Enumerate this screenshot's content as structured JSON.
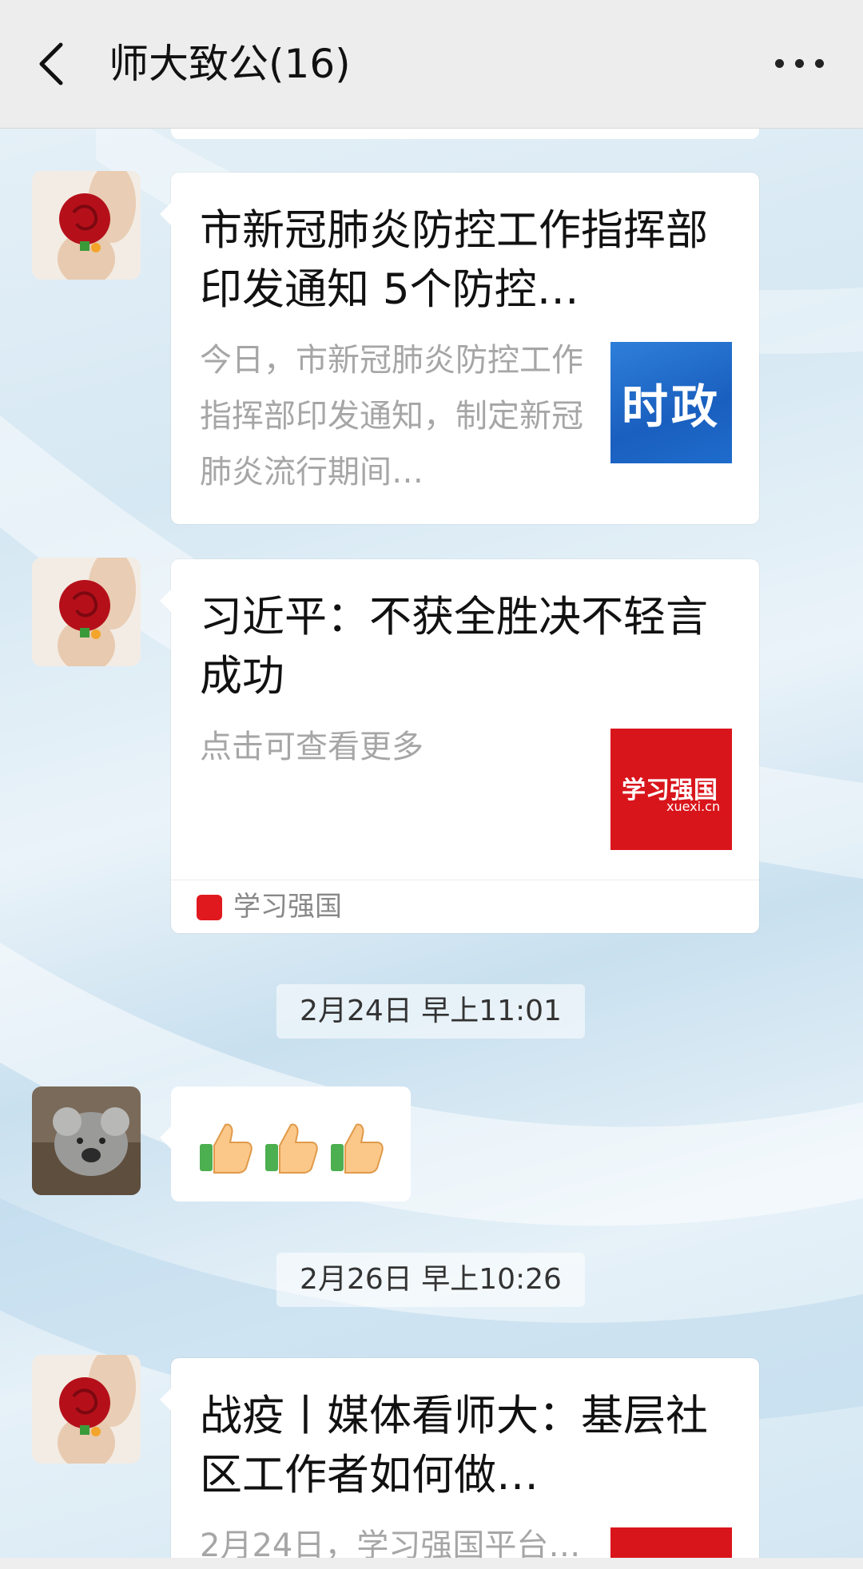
{
  "header": {
    "title": "师大致公(16)"
  },
  "messages": [
    {
      "type": "link-card",
      "title": "市新冠肺炎防控工作指挥部印发通知 5个防控…",
      "description": "今日，市新冠肺炎防控工作指挥部印发通知，制定新冠肺炎流行期间…",
      "thumbnail_text": "时政"
    },
    {
      "type": "link-card",
      "title": "习近平：不获全胜决不轻言成功",
      "description": "点击可查看更多",
      "thumbnail_text": "学习强国",
      "thumbnail_subtext": "xuexi.cn",
      "source": "学习强国"
    },
    {
      "type": "timestamp",
      "text": "2月24日 早上11:01"
    },
    {
      "type": "emoji",
      "content": "👍👍👍"
    },
    {
      "type": "timestamp",
      "text": "2月26日 早上10:26"
    },
    {
      "type": "link-card",
      "title": "战疫丨媒体看师大：基层社区工作者如何做…",
      "description": "2月24日，学习强国平台…"
    }
  ],
  "colors": {
    "header_bg": "#ededed",
    "xuexi_red": "#d9151c",
    "shizheng_blue": "#1a5fbf"
  }
}
